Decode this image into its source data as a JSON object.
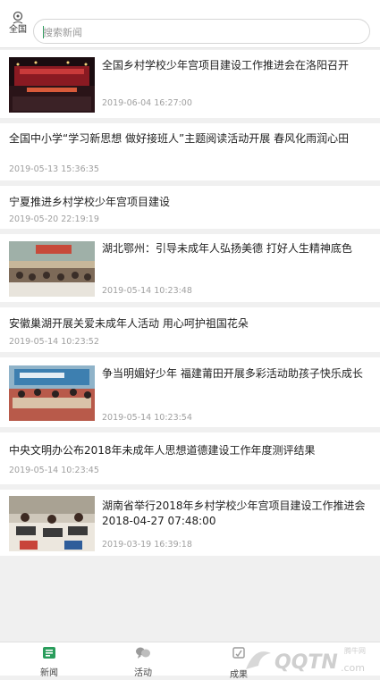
{
  "header": {
    "location_icon": "location-pin-icon",
    "location_label": "全国",
    "search_placeholder": "搜索新闻"
  },
  "news": [
    {
      "title": "全国乡村学校少年宫项目建设工作推进会在洛阳召开",
      "date": "2019-06-04 16:27:00",
      "has_image": true
    },
    {
      "title": "全国中小学“学习新思想 做好接班人”主题阅读活动开展 春风化雨润心田",
      "date": "2019-05-13 15:36:35",
      "has_image": false
    },
    {
      "title": "宁夏推进乡村学校少年宫项目建设",
      "date": "2019-05-20 22:19:19",
      "has_image": false
    },
    {
      "title": "湖北鄂州：引导未成年人弘扬美德 打好人生精神底色",
      "date": "2019-05-14 10:23:48",
      "has_image": true
    },
    {
      "title": "安徽巢湖开展关爱未成年人活动 用心呵护祖国花朵",
      "date": "2019-05-14 10:23:52",
      "has_image": false
    },
    {
      "title": "争当明媚好少年 福建莆田开展多彩活动助孩子快乐成长",
      "date": "2019-05-14 10:23:54",
      "has_image": true
    },
    {
      "title": "中央文明办公布2018年未成年人思想道德建设工作年度测评结果",
      "date": "2019-05-14 10:23:45",
      "has_image": false
    },
    {
      "title": "湖南省举行2018年乡村学校少年宫项目建设工作推进会 2018-04-27 07:48:00",
      "date": "2019-03-19 16:39:18",
      "has_image": true
    }
  ],
  "tabs": [
    {
      "label": "新闻",
      "icon": "news-icon",
      "active": true
    },
    {
      "label": "活动",
      "icon": "activity-icon",
      "active": false
    },
    {
      "label": "成果",
      "icon": "achievement-icon",
      "active": false
    }
  ],
  "watermark": {
    "text_top": "腾牛网",
    "text_main": "QQTN",
    "text_suffix": ".com"
  },
  "colors": {
    "accent": "#2a9d5c",
    "text": "#222222",
    "date": "#a0a0a0",
    "background": "#f0f0f0"
  }
}
